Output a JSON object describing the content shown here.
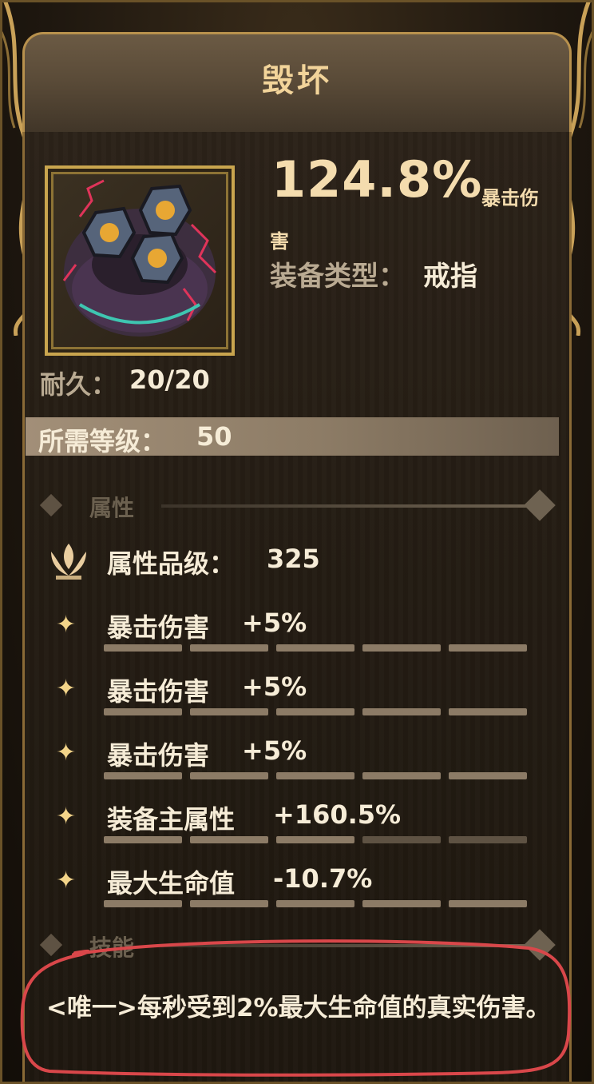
{
  "item": {
    "title": "毁坏",
    "main_stat_value": "124.8%",
    "main_stat_name_part1": "暴击伤",
    "main_stat_name_part2": "害",
    "type_label": "装备类型：",
    "type_value": "戒指",
    "durability_label": "耐久：",
    "durability_value": "20/20",
    "required_level_label": "所需等级：",
    "required_level_value": "50",
    "icon": "ring-icon"
  },
  "attributes": {
    "section_label": "属性",
    "grade_label": "属性品级：",
    "grade_value": "325",
    "rows": [
      {
        "name": "暴击伤害",
        "value": "+5%"
      },
      {
        "name": "暴击伤害",
        "value": "+5%"
      },
      {
        "name": "暴击伤害",
        "value": "+5%"
      },
      {
        "name": "装备主属性",
        "value": "+160.5%"
      },
      {
        "name": "最大生命值",
        "value": "-10.7%"
      }
    ]
  },
  "skills": {
    "section_label": "技能",
    "description": "<唯一>每秒受到2%最大生命值的真实伤害。"
  },
  "colors": {
    "gold": "#f3d489",
    "text": "#f6ecd7",
    "muted": "#b9aa92",
    "highlight_outline": "#d9474a"
  }
}
